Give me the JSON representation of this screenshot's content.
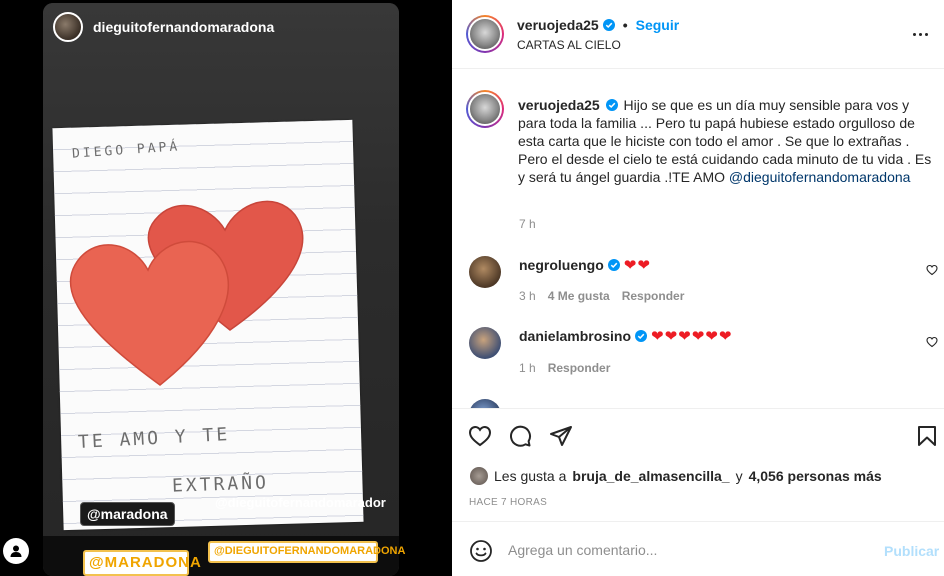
{
  "story": {
    "username": "dieguitofernandomaradona",
    "handwriting_top": "DIEGO PAPÁ",
    "handwriting_mid": "TE AMO Y TE",
    "handwriting_bottom": "EXTRAÑO",
    "sticker_1": "@maradona",
    "sticker_2": "@dieguitofernandomarador",
    "sticker_3": "@MARADONA",
    "sticker_4": "@DIEGUITOFERNANDOMARADONA"
  },
  "post": {
    "username": "veruojeda25",
    "separator": "•",
    "follow_label": "Seguir",
    "location": "CARTAS AL CIELO"
  },
  "caption": {
    "username": "veruojeda25",
    "text": "Hijo se que es un día muy sensible para vos y para toda la familia ... Pero tu papá hubiese estado orgulloso de esta carta que le hiciste con todo el amor . Se que lo extrañas . Pero el desde el cielo te está cuidando cada minuto de tu vida . Es y será tu ángel guardia .!TE AMO",
    "mention": "@dieguitofernandomaradona",
    "time": "7 h"
  },
  "comments": [
    {
      "username": "negroluengo",
      "text": "❤❤",
      "time": "3 h",
      "likes": "4 Me gusta",
      "reply": "Responder"
    },
    {
      "username": "danielambrosino",
      "text": "❤❤❤❤❤❤",
      "time": "1 h",
      "likes": "",
      "reply": "Responder"
    }
  ],
  "likes": {
    "prefix": "Les gusta a",
    "user": "bruja_de_almasencilla_",
    "middle": "y",
    "count": "4,056 personas más",
    "ago": "HACE 7 HORAS"
  },
  "add_comment": {
    "placeholder": "Agrega un comentario...",
    "publish_label": "Publicar"
  },
  "colors": {
    "accent": "#0095f6",
    "heart": "#ed1c24",
    "publish_disabled": "#b2dffc"
  },
  "icons": [
    "like-icon",
    "comment-icon",
    "share-icon",
    "save-icon",
    "emoji-icon",
    "more-icon",
    "verified-icon",
    "user-icon"
  ]
}
